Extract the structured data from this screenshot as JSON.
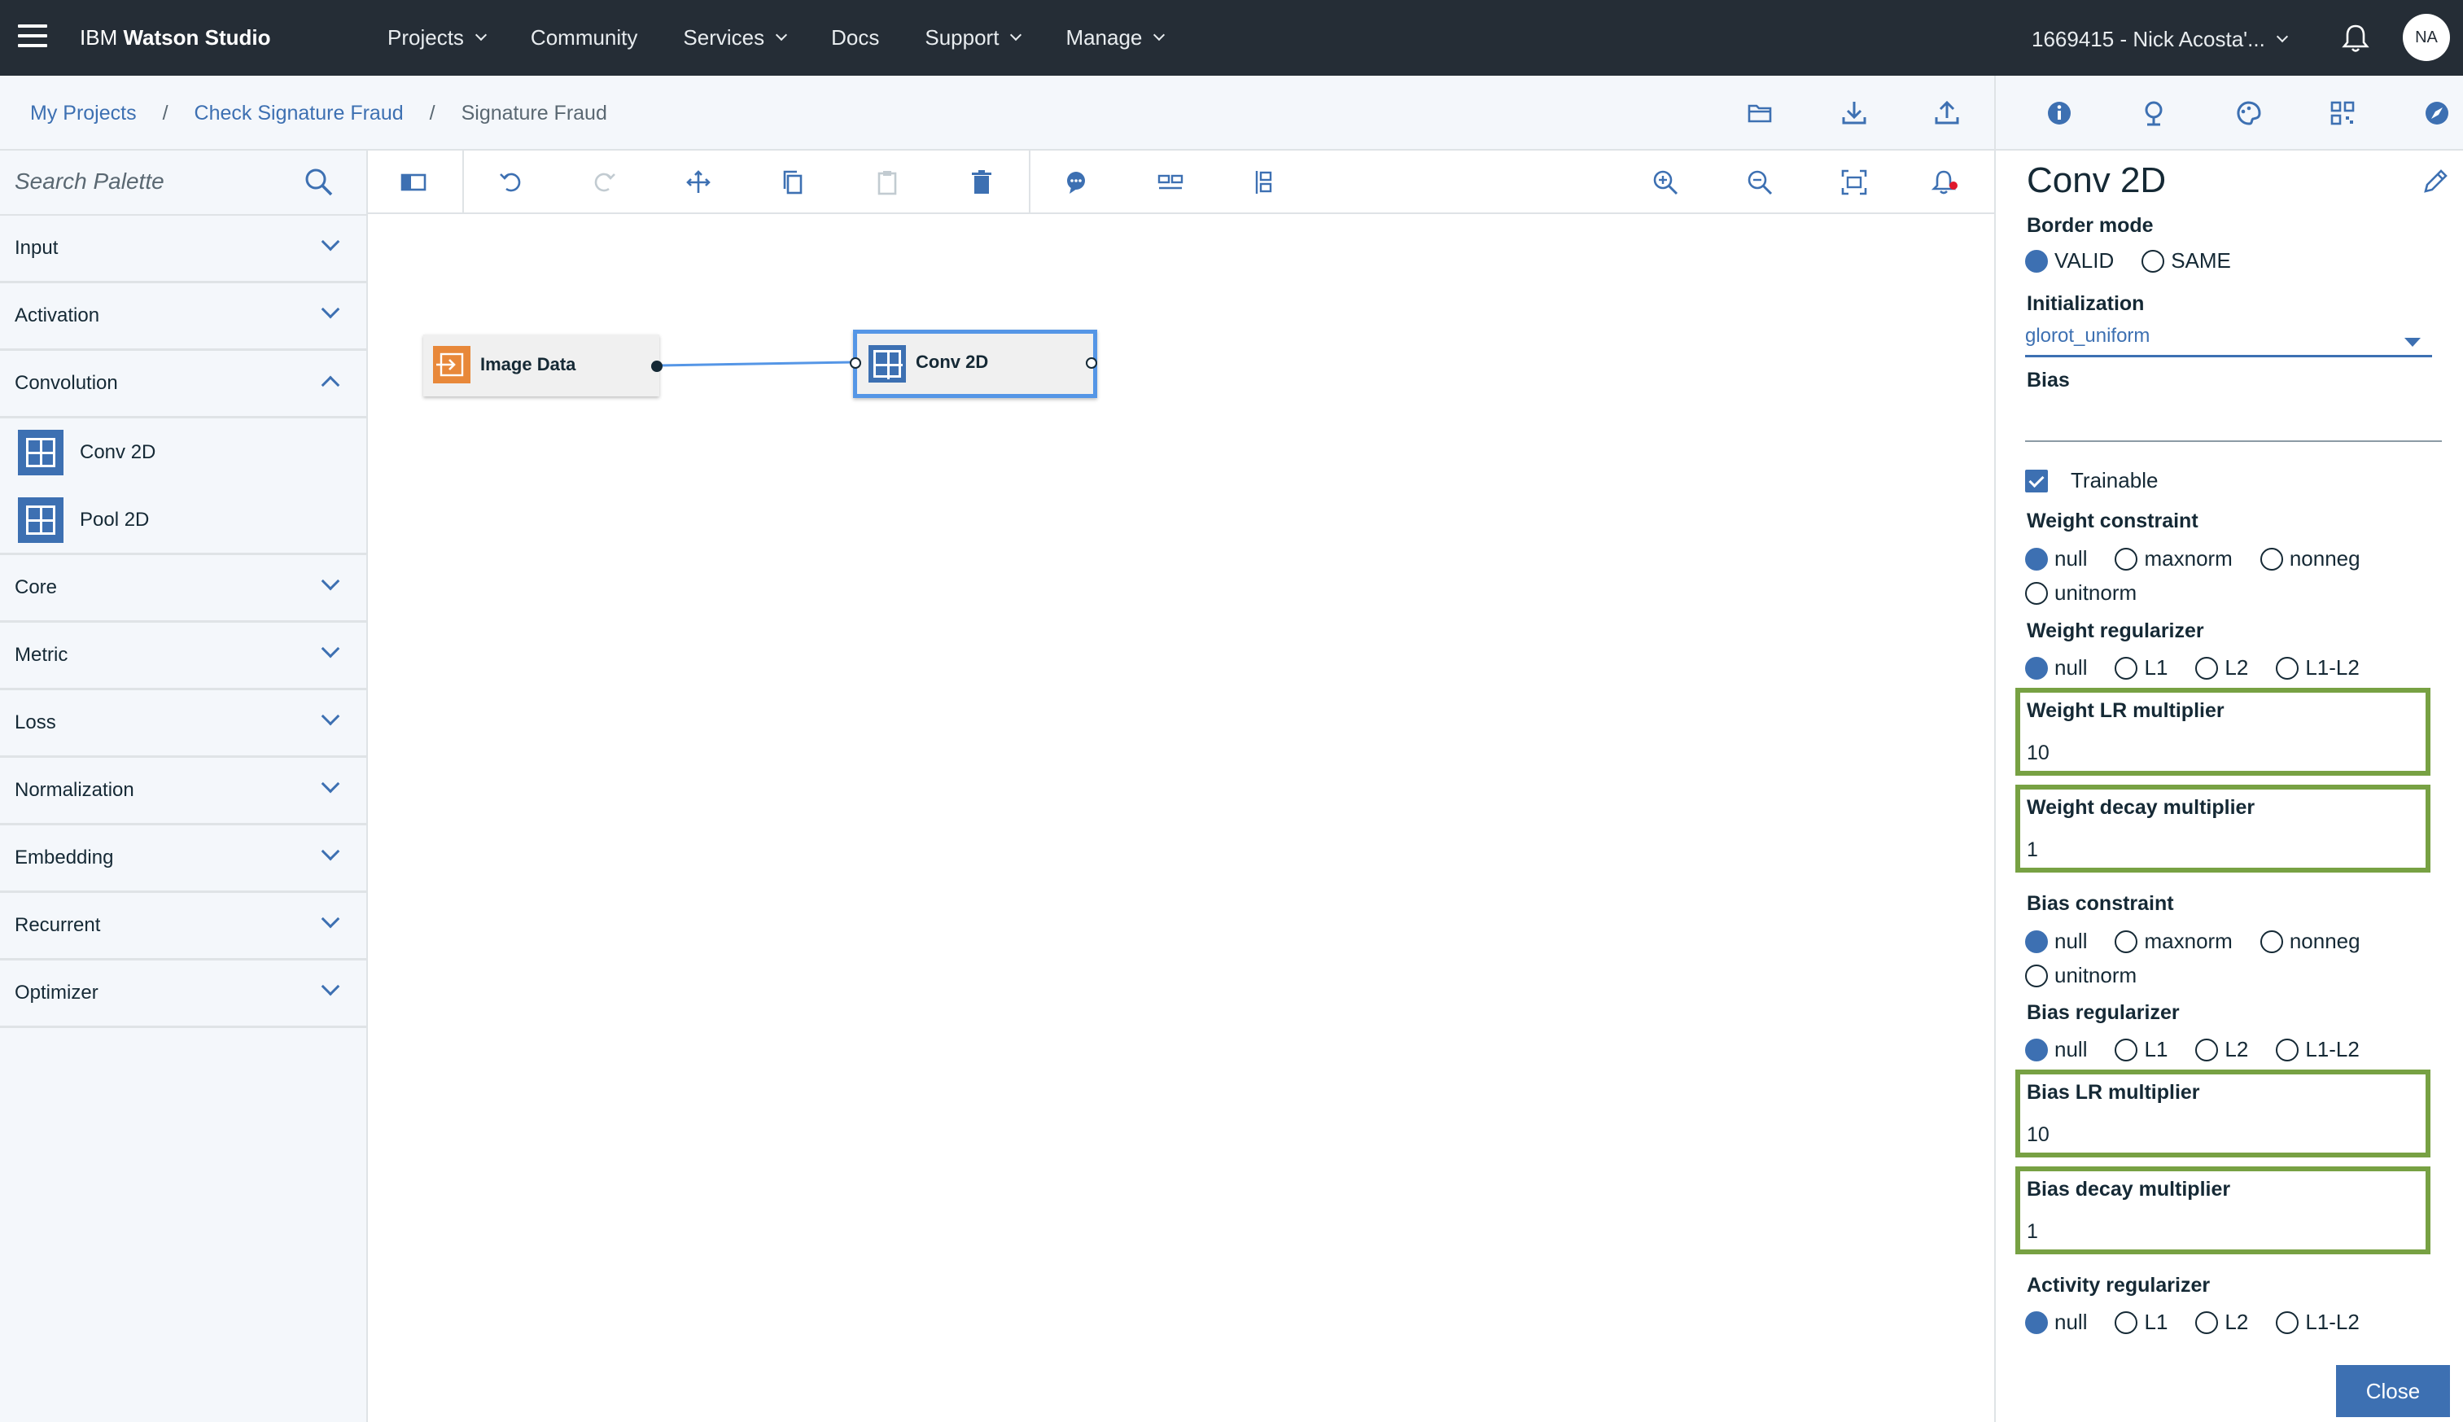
{
  "header": {
    "brand_prefix": "IBM",
    "brand_name": "Watson Studio",
    "nav": [
      {
        "label": "Projects",
        "has_menu": true
      },
      {
        "label": "Community",
        "has_menu": false
      },
      {
        "label": "Services",
        "has_menu": true
      },
      {
        "label": "Docs",
        "has_menu": false
      },
      {
        "label": "Support",
        "has_menu": true
      },
      {
        "label": "Manage",
        "has_menu": true
      }
    ],
    "account": "1669415 - Nick Acosta'...",
    "avatar_initials": "NA"
  },
  "breadcrumb": {
    "items": [
      "My Projects",
      "Check Signature Fraud"
    ],
    "separator": "/",
    "current": "Signature Fraud"
  },
  "palette": {
    "search_placeholder": "Search Palette",
    "categories": [
      {
        "label": "Input",
        "expanded": false
      },
      {
        "label": "Activation",
        "expanded": false
      },
      {
        "label": "Convolution",
        "expanded": true,
        "children": [
          "Conv 2D",
          "Pool 2D"
        ]
      },
      {
        "label": "Core",
        "expanded": false
      },
      {
        "label": "Metric",
        "expanded": false
      },
      {
        "label": "Loss",
        "expanded": false
      },
      {
        "label": "Normalization",
        "expanded": false
      },
      {
        "label": "Embedding",
        "expanded": false
      },
      {
        "label": "Recurrent",
        "expanded": false
      },
      {
        "label": "Optimizer",
        "expanded": false
      }
    ]
  },
  "canvas": {
    "nodes": [
      {
        "label": "Image Data",
        "type": "input",
        "selected": false
      },
      {
        "label": "Conv 2D",
        "type": "conv",
        "selected": true
      }
    ]
  },
  "properties": {
    "title": "Conv 2D",
    "border_mode": {
      "label": "Border mode",
      "options": [
        "VALID",
        "SAME"
      ],
      "selected": "VALID"
    },
    "initialization": {
      "label": "Initialization",
      "value": "glorot_uniform"
    },
    "bias": {
      "label": "Bias",
      "value": ""
    },
    "trainable": {
      "label": "Trainable",
      "checked": true
    },
    "weight_constraint": {
      "label": "Weight constraint",
      "options": [
        "null",
        "maxnorm",
        "nonneg",
        "unitnorm"
      ],
      "selected": "null"
    },
    "weight_regularizer": {
      "label": "Weight regularizer",
      "options": [
        "null",
        "L1",
        "L2",
        "L1-L2"
      ],
      "selected": "null"
    },
    "weight_lr_multiplier": {
      "label": "Weight LR multiplier",
      "value": "10"
    },
    "weight_decay_multiplier": {
      "label": "Weight decay multiplier",
      "value": "1"
    },
    "bias_constraint": {
      "label": "Bias constraint",
      "options": [
        "null",
        "maxnorm",
        "nonneg",
        "unitnorm"
      ],
      "selected": "null"
    },
    "bias_regularizer": {
      "label": "Bias regularizer",
      "options": [
        "null",
        "L1",
        "L2",
        "L1-L2"
      ],
      "selected": "null"
    },
    "bias_lr_multiplier": {
      "label": "Bias LR multiplier",
      "value": "10"
    },
    "bias_decay_multiplier": {
      "label": "Bias decay multiplier",
      "value": "1"
    },
    "activity_regularizer": {
      "label": "Activity regularizer",
      "options": [
        "null",
        "L1",
        "L2",
        "L1-L2"
      ],
      "selected": "null"
    },
    "close_label": "Close"
  },
  "colors": {
    "topbar": "#252d36",
    "accent": "#3d70b2",
    "highlight": "#77a143",
    "input_node": "#e8883a",
    "selected_outline": "#5596e6"
  },
  "icons": {
    "topbar": [
      "menu-icon",
      "bell-icon"
    ],
    "breadcrumb_tools": [
      "folder-icon",
      "download-icon",
      "upload-icon"
    ],
    "panel_tabs": [
      "info-icon",
      "hierarchy-icon",
      "palette-icon",
      "qr-icon",
      "compass-icon"
    ],
    "toolbar": [
      "toggle-palette-icon",
      "undo-icon",
      "redo-icon",
      "move-icon",
      "copy-icon",
      "paste-icon",
      "delete-icon",
      "comment-icon",
      "arrange-horizontal-icon",
      "arrange-vertical-icon",
      "zoom-in-icon",
      "zoom-out-icon",
      "fit-to-screen-icon",
      "notification-icon"
    ]
  }
}
